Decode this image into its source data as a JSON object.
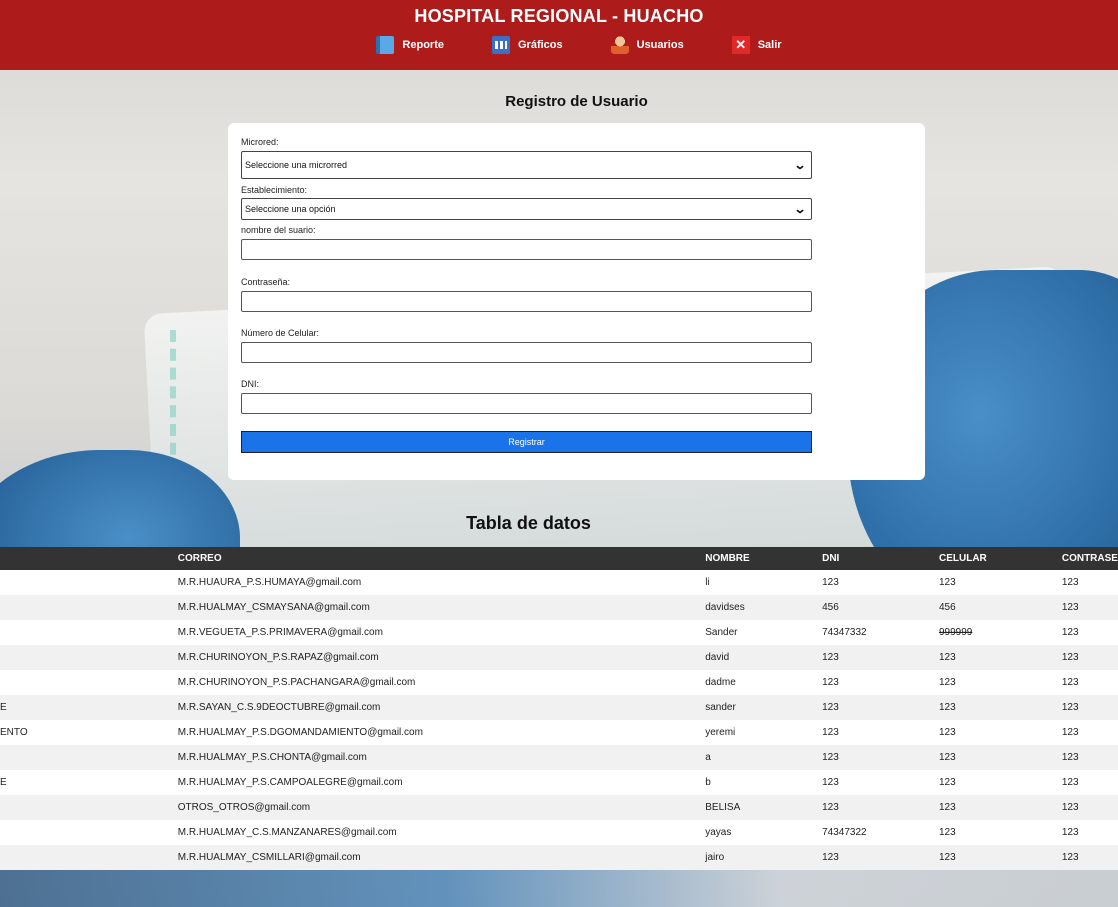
{
  "header": {
    "title": "HOSPITAL REGIONAL - HUACHO",
    "nav": [
      {
        "label": "Reporte",
        "icon": "report-icon"
      },
      {
        "label": "Gráficos",
        "icon": "chart-icon"
      },
      {
        "label": "Usuarios",
        "icon": "user-icon"
      },
      {
        "label": "Salir",
        "icon": "exit-icon"
      }
    ]
  },
  "form": {
    "title": "Registro de Usuario",
    "microred_label": "Microred:",
    "microred_value": "Seleccione una microrred",
    "establecimiento_label": "Establecimiento:",
    "establecimiento_value": "Seleccione una opción",
    "usuario_label": "nombre del suario:",
    "password_label": "Contraseña:",
    "celular_label": "Número de Celular:",
    "dni_label": "DNI:",
    "submit_label": "Registrar"
  },
  "table": {
    "title": "Tabla de datos",
    "columns": [
      "",
      "CORREO",
      "NOMBRE",
      "DNI",
      "CELULAR",
      "CONTRASE"
    ],
    "rows": [
      [
        "",
        "M.R.HUAURA_P.S.HUMAYA@gmail.com",
        "li",
        "123",
        "123",
        "123"
      ],
      [
        "",
        "M.R.HUALMAY_CSMAYSANA@gmail.com",
        "davidses",
        "456",
        "456",
        "123"
      ],
      [
        "",
        "M.R.VEGUETA_P.S.PRIMAVERA@gmail.com",
        "Sander",
        "74347332",
        "999999",
        "123"
      ],
      [
        "",
        "M.R.CHURINOYON_P.S.RAPAZ@gmail.com",
        "david",
        "123",
        "123",
        "123"
      ],
      [
        "",
        "M.R.CHURINOYON_P.S.PACHANGARA@gmail.com",
        "dadme",
        "123",
        "123",
        "123"
      ],
      [
        "E",
        "M.R.SAYAN_C.S.9DEOCTUBRE@gmail.com",
        "sander",
        "123",
        "123",
        "123"
      ],
      [
        "ENTO",
        "M.R.HUALMAY_P.S.DGOMANDAMIENTO@gmail.com",
        "yeremi",
        "123",
        "123",
        "123"
      ],
      [
        "",
        "M.R.HUALMAY_P.S.CHONTA@gmail.com",
        "a",
        "123",
        "123",
        "123"
      ],
      [
        "E",
        "M.R.HUALMAY_P.S.CAMPOALEGRE@gmail.com",
        "b",
        "123",
        "123",
        "123"
      ],
      [
        "",
        "OTROS_OTROS@gmail.com",
        "BELISA",
        "123",
        "123",
        "123"
      ],
      [
        "",
        "M.R.HUALMAY_C.S.MANZANARES@gmail.com",
        "yayas",
        "74347322",
        "123",
        "123"
      ],
      [
        "",
        "M.R.HUALMAY_CSMILLARI@gmail.com",
        "jairo",
        "123",
        "123",
        "123"
      ]
    ]
  }
}
